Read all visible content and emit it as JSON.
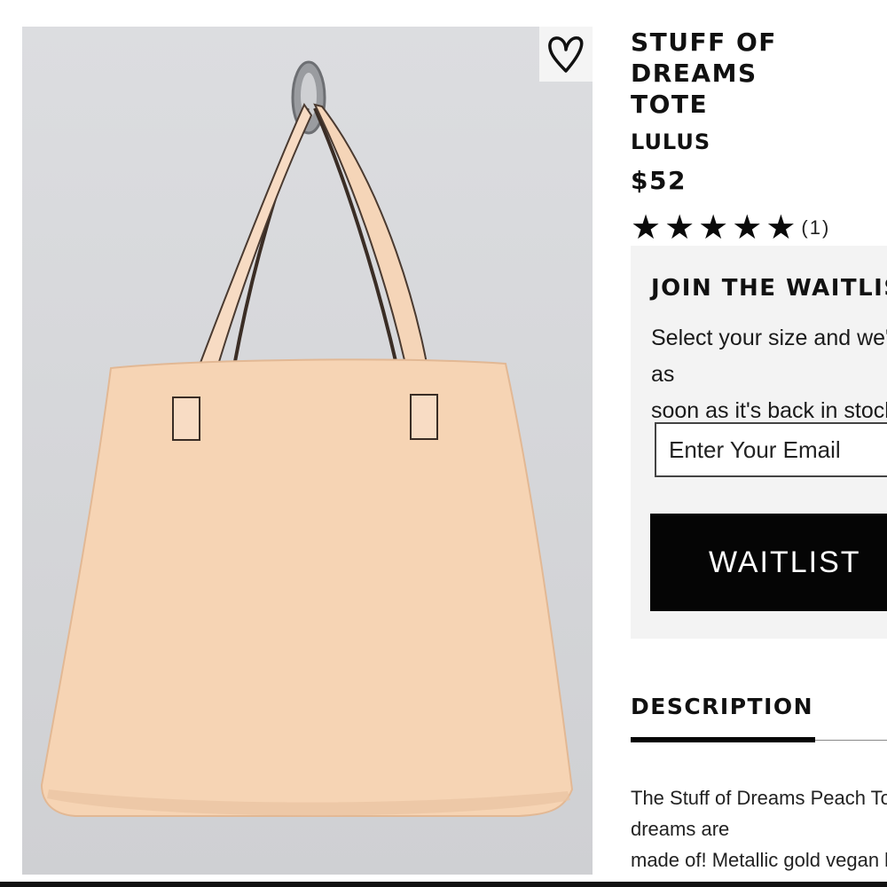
{
  "product": {
    "title": "STUFF OF DREAMS\nTOTE",
    "brand": "LULUS",
    "price": "$52",
    "rating": {
      "stars": 5,
      "max_stars": 5,
      "star_glyph": "★",
      "count": "(1)"
    },
    "image_alt": "Peach tote bag hanging on a wall hook",
    "favorite_icon": "heart-outline-icon"
  },
  "waitlist": {
    "heading": "JOIN THE WAITLIST",
    "description": "Select your size and we'll email you as\nsoon as it's back in stock.",
    "email_placeholder": "Enter Your Email",
    "button_label": "WAITLIST"
  },
  "tabs": {
    "description_label": "DESCRIPTION"
  },
  "description": {
    "text": "The Stuff of Dreams Peach Tote is what dreams are\nmade of! Metallic gold vegan leather\nforms this versatile tote bag"
  },
  "colors": {
    "accent": "#050505",
    "panel_bg": "#f3f3f3",
    "bag": "#f6d6b8"
  }
}
